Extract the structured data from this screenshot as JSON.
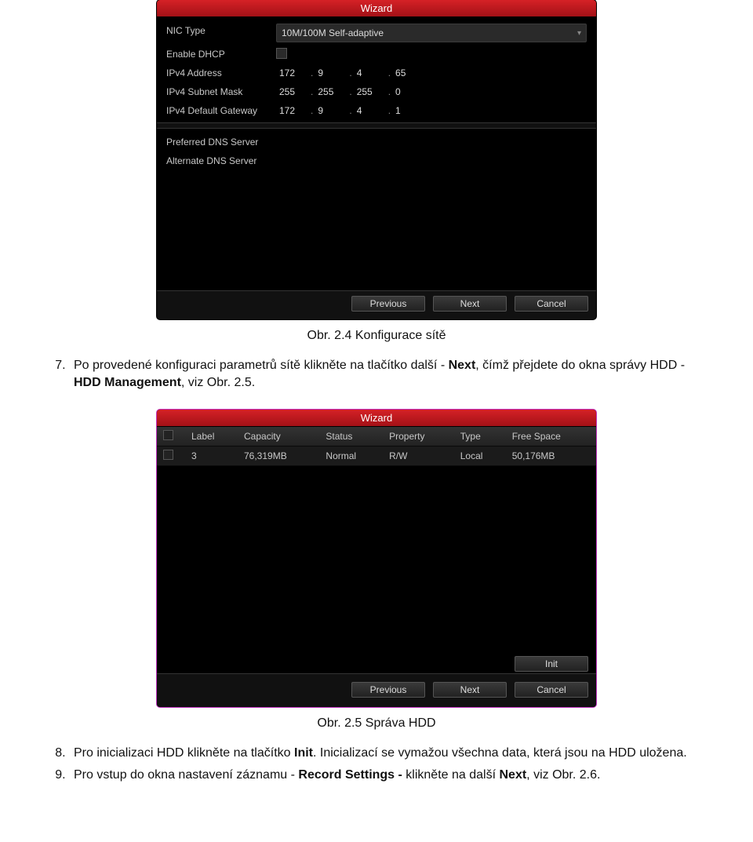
{
  "wizard1": {
    "title": "Wizard",
    "fields": {
      "nic_type_label": "NIC Type",
      "nic_type_value": "10M/100M Self-adaptive",
      "enable_dhcp_label": "Enable DHCP",
      "ipv4_addr_label": "IPv4 Address",
      "ipv4_addr": [
        "172",
        "9",
        "4",
        "65"
      ],
      "ipv4_mask_label": "IPv4 Subnet Mask",
      "ipv4_mask": [
        "255",
        "255",
        "255",
        "0"
      ],
      "ipv4_gw_label": "IPv4 Default Gateway",
      "ipv4_gw": [
        "172",
        "9",
        "4",
        "1"
      ],
      "pref_dns_label": "Preferred DNS Server",
      "pref_dns_value": "",
      "alt_dns_label": "Alternate DNS Server",
      "alt_dns_value": ""
    },
    "buttons": {
      "previous": "Previous",
      "next": "Next",
      "cancel": "Cancel"
    }
  },
  "captions": {
    "fig24": "Obr. 2.4 Konfigurace sítě",
    "fig25": "Obr. 2.5 Správa HDD"
  },
  "para7": {
    "num": "7",
    "before": "Po provedené konfiguraci parametrů sítě klikněte na tlačítko další - ",
    "bold1": "Next",
    "mid": ", čímž přejdete do okna správy HDD - ",
    "bold2": "HDD Management",
    "after": ", viz Obr. 2.5."
  },
  "wizard2": {
    "title": "Wizard",
    "headers": {
      "chk": "",
      "label": "Label",
      "capacity": "Capacity",
      "status": "Status",
      "property": "Property",
      "type": "Type",
      "free": "Free Space"
    },
    "row": {
      "label": "3",
      "capacity": "76,319MB",
      "status": "Normal",
      "property": "R/W",
      "type": "Local",
      "free": "50,176MB"
    },
    "buttons": {
      "init": "Init",
      "previous": "Previous",
      "next": "Next",
      "cancel": "Cancel"
    }
  },
  "para8": {
    "num": "8",
    "before": "Pro inicializaci HDD klikněte na tlačítko ",
    "bold1": "Init",
    "after": ". Inicializací se vymažou všechna data, která jsou na HDD uložena."
  },
  "para9": {
    "num": "9",
    "before": "Pro vstup do okna nastavení záznamu - ",
    "bold1": "Record Settings - ",
    "mid": "klikněte na další ",
    "bold2": "Next",
    "after": ", viz Obr. 2.6."
  }
}
